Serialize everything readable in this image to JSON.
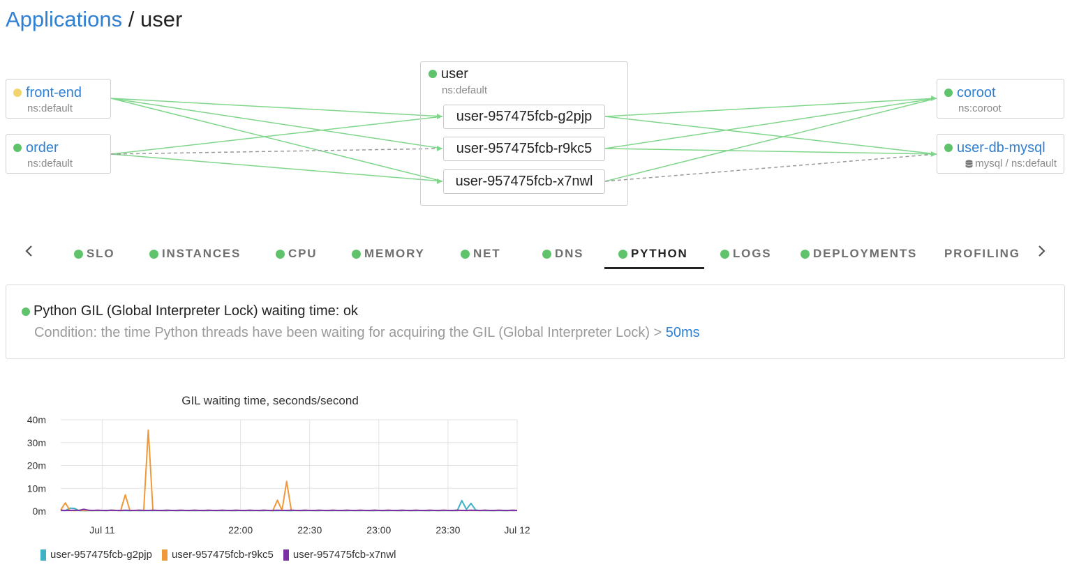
{
  "breadcrumb": {
    "root": "Applications",
    "separator": " / ",
    "current": "user"
  },
  "colors": {
    "link": "#2f7fd3",
    "ok": "#5ec36b",
    "warning": "#f3d46c",
    "edge": "#7fd68a",
    "edge_dashed": "#999999"
  },
  "map": {
    "center": {
      "name": "user",
      "ns": "ns:default",
      "instances": [
        "user-957475fcb-g2pjp",
        "user-957475fcb-r9kc5",
        "user-957475fcb-x7nwl"
      ]
    },
    "clients": [
      {
        "name": "front-end",
        "ns": "ns:default",
        "status": "warning"
      },
      {
        "name": "order",
        "ns": "ns:default",
        "status": "ok"
      }
    ],
    "dependencies": [
      {
        "name": "coroot",
        "ns": "ns:coroot",
        "status": "ok"
      },
      {
        "name": "user-db-mysql",
        "ns": "mysql / ns:default",
        "status": "ok",
        "icon": "database-icon"
      }
    ]
  },
  "tabs": [
    {
      "label": "SLO",
      "status": "ok"
    },
    {
      "label": "INSTANCES",
      "status": "ok"
    },
    {
      "label": "CPU",
      "status": "ok"
    },
    {
      "label": "MEMORY",
      "status": "ok"
    },
    {
      "label": "NET",
      "status": "ok"
    },
    {
      "label": "DNS",
      "status": "ok"
    },
    {
      "label": "PYTHON",
      "status": "ok",
      "active": true
    },
    {
      "label": "LOGS",
      "status": "ok"
    },
    {
      "label": "DEPLOYMENTS",
      "status": "ok"
    },
    {
      "label": "PROFILING"
    }
  ],
  "check": {
    "title": "Python GIL (Global Interpreter Lock) waiting time: ok",
    "condition": "Condition: the time Python threads have been waiting for acquiring the GIL (Global Interpreter Lock) > ",
    "threshold": "50ms"
  },
  "chart_data": {
    "type": "line",
    "title": "GIL waiting time, seconds/second",
    "y_ticks": [
      "40m",
      "30m",
      "20m",
      "10m",
      "0m"
    ],
    "y_tick_values": [
      0.04,
      0.03,
      0.02,
      0.01,
      0
    ],
    "ylim": [
      0,
      0.04
    ],
    "x_ticks": [
      "Jul 11",
      "22:00",
      "22:30",
      "23:00",
      "23:30",
      "Jul 12"
    ],
    "x_tick_minutes": [
      0,
      60,
      90,
      120,
      150,
      180
    ],
    "xlim_minutes": [
      -18,
      180
    ],
    "x_offsets": [
      -18,
      -16,
      -14,
      -12,
      -10,
      -8,
      -6,
      -4,
      -2,
      0,
      2,
      4,
      6,
      8,
      10,
      12,
      14,
      16,
      18,
      20,
      22,
      24,
      26,
      28,
      30,
      32,
      34,
      36,
      38,
      40,
      42,
      44,
      46,
      48,
      50,
      52,
      54,
      56,
      58,
      60,
      62,
      64,
      66,
      68,
      70,
      72,
      74,
      76,
      78,
      80,
      82,
      84,
      86,
      88,
      90,
      92,
      94,
      96,
      98,
      100,
      102,
      104,
      106,
      108,
      110,
      112,
      114,
      116,
      118,
      120,
      122,
      124,
      126,
      128,
      130,
      132,
      134,
      136,
      138,
      140,
      142,
      144,
      146,
      148,
      150,
      152,
      154,
      156,
      158,
      160,
      162,
      164,
      166,
      168,
      170,
      172,
      174,
      176,
      178,
      180
    ],
    "grid": true,
    "legend_position": "bottom-left",
    "series": [
      {
        "name": "user-957475fcb-g2pjp",
        "color": "#3fb1c5",
        "values": [
          0.0003,
          0.0002,
          0.0013,
          0.0012,
          0.0002,
          0.0002,
          0.0002,
          0.0003,
          0.0002,
          0.0003,
          0.0002,
          0.0004,
          0.0003,
          0.0002,
          0.0003,
          0.0002,
          0.0003,
          0.0002,
          0.0002,
          0.0003,
          0.0002,
          0.0003,
          0.0002,
          0.0002,
          0.0003,
          0.0002,
          0.0002,
          0.0003,
          0.0002,
          0.0002,
          0.0003,
          0.0002,
          0.0002,
          0.0003,
          0.0002,
          0.0002,
          0.0003,
          0.0002,
          0.0002,
          0.0003,
          0.0002,
          0.0002,
          0.0003,
          0.0002,
          0.0002,
          0.0003,
          0.0002,
          0.0002,
          0.0003,
          0.0002,
          0.0002,
          0.0003,
          0.0002,
          0.0002,
          0.0003,
          0.0002,
          0.0002,
          0.0003,
          0.0002,
          0.0002,
          0.0003,
          0.0002,
          0.0002,
          0.0003,
          0.0002,
          0.0002,
          0.0003,
          0.0002,
          0.0002,
          0.0003,
          0.0002,
          0.0002,
          0.0003,
          0.0002,
          0.0002,
          0.0003,
          0.0002,
          0.0002,
          0.0003,
          0.0002,
          0.0002,
          0.0003,
          0.0002,
          0.0002,
          0.0003,
          0.0002,
          0.0002,
          0.0046,
          0.0008,
          0.0034,
          0.0005,
          0.0002,
          0.0003,
          0.0002,
          0.0002,
          0.0003,
          0.0002,
          0.0002,
          0.0003,
          0.0002
        ]
      },
      {
        "name": "user-957475fcb-r9kc5",
        "color": "#f0993a",
        "values": [
          0.0005,
          0.0036,
          0.0003,
          0.0002,
          0.0004,
          0.0002,
          0.0003,
          0.0002,
          0.0004,
          0.0003,
          0.0002,
          0.0004,
          0.0003,
          0.0002,
          0.0071,
          0.0003,
          0.0002,
          0.0004,
          0.0003,
          0.0355,
          0.0004,
          0.0003,
          0.0002,
          0.0004,
          0.0003,
          0.0002,
          0.0004,
          0.0003,
          0.0002,
          0.0004,
          0.0003,
          0.0002,
          0.0004,
          0.0003,
          0.0002,
          0.0004,
          0.0003,
          0.0002,
          0.0004,
          0.0003,
          0.0002,
          0.0004,
          0.0003,
          0.0002,
          0.0004,
          0.0003,
          0.0002,
          0.0048,
          0.0003,
          0.013,
          0.0004,
          0.0003,
          0.0002,
          0.0004,
          0.0003,
          0.0002,
          0.0004,
          0.0003,
          0.0002,
          0.0004,
          0.0003,
          0.0002,
          0.0004,
          0.0003,
          0.0002,
          0.0004,
          0.0003,
          0.0002,
          0.0004,
          0.0003,
          0.0002,
          0.0004,
          0.0003,
          0.0002,
          0.0004,
          0.0003,
          0.0002,
          0.0004,
          0.0003,
          0.0002,
          0.0004,
          0.0003,
          0.0002,
          0.0004,
          0.0003,
          0.0002,
          0.0004,
          0.0003,
          0.0002,
          0.0004,
          0.0003,
          0.0002,
          0.0004,
          0.0003,
          0.0002,
          0.0004,
          0.0003,
          0.0002,
          0.0004,
          0.0003
        ]
      },
      {
        "name": "user-957475fcb-x7nwl",
        "color": "#7b2fa6",
        "values": [
          0.0004,
          0.0003,
          0.0003,
          0.0004,
          0.0003,
          0.0008,
          0.0004,
          0.0003,
          0.0004,
          0.0003,
          0.0003,
          0.0004,
          0.0003,
          0.0003,
          0.0004,
          0.0003,
          0.0003,
          0.0004,
          0.0003,
          0.0003,
          0.0004,
          0.0003,
          0.0003,
          0.0004,
          0.0003,
          0.0003,
          0.0004,
          0.0003,
          0.0003,
          0.0004,
          0.0003,
          0.0003,
          0.0004,
          0.0003,
          0.0003,
          0.0004,
          0.0003,
          0.0003,
          0.0004,
          0.0003,
          0.0003,
          0.0004,
          0.0003,
          0.0003,
          0.0004,
          0.0003,
          0.0003,
          0.0004,
          0.0003,
          0.0003,
          0.0004,
          0.0003,
          0.0003,
          0.0004,
          0.0003,
          0.0003,
          0.0004,
          0.0003,
          0.0003,
          0.0004,
          0.0003,
          0.0003,
          0.0004,
          0.0003,
          0.0003,
          0.0004,
          0.0003,
          0.0003,
          0.0004,
          0.0003,
          0.0003,
          0.0004,
          0.0003,
          0.0003,
          0.0004,
          0.0003,
          0.0003,
          0.0004,
          0.0003,
          0.0003,
          0.0004,
          0.0003,
          0.0003,
          0.0004,
          0.0003,
          0.0003,
          0.0004,
          0.0003,
          0.0003,
          0.0004,
          0.0003,
          0.0003,
          0.0004,
          0.0003,
          0.0003,
          0.0004,
          0.0003,
          0.0003,
          0.0004,
          0.0003
        ]
      }
    ]
  }
}
